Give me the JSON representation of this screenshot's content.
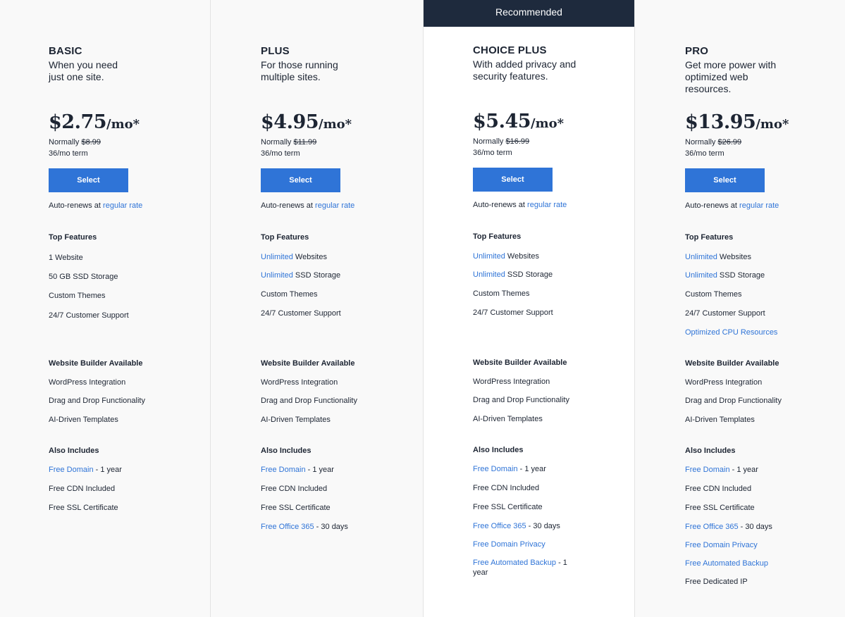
{
  "recommended_label": "Recommended",
  "plans": [
    {
      "name": "BASIC",
      "description": "When you need just one site.",
      "price": "$2.75",
      "per": "/mo*",
      "normally_label": "Normally",
      "normal_price": "$8.99",
      "term": "36/mo term",
      "select_label": "Select",
      "auto_renew_text": "Auto-renews at",
      "auto_renew_link": "regular rate",
      "top_features_title": "Top Features",
      "top_features": [
        {
          "link": "",
          "text": "1 Website"
        },
        {
          "link": "",
          "text": "50 GB SSD Storage"
        },
        {
          "link": "",
          "text": "Custom Themes"
        },
        {
          "link": "",
          "text": "24/7 Customer Support"
        }
      ],
      "builder_title": "Website Builder Available",
      "builder_features": [
        "WordPress Integration",
        "Drag and Drop Functionality",
        "AI-Driven Templates"
      ],
      "also_title": "Also Includes",
      "also_includes": [
        {
          "link": "Free Domain",
          "text": " - 1 year"
        },
        {
          "link": "",
          "text": "Free CDN Included"
        },
        {
          "link": "",
          "text": "Free SSL Certificate"
        }
      ]
    },
    {
      "name": "PLUS",
      "description": "For those running multiple sites.",
      "price": "$4.95",
      "per": "/mo*",
      "normally_label": "Normally",
      "normal_price": "$11.99",
      "term": "36/mo term",
      "select_label": "Select",
      "auto_renew_text": "Auto-renews at",
      "auto_renew_link": "regular rate",
      "top_features_title": "Top Features",
      "top_features": [
        {
          "link": "Unlimited",
          "text": " Websites"
        },
        {
          "link": "Unlimited",
          "text": " SSD Storage"
        },
        {
          "link": "",
          "text": "Custom Themes"
        },
        {
          "link": "",
          "text": "24/7 Customer Support"
        }
      ],
      "builder_title": "Website Builder Available",
      "builder_features": [
        "WordPress Integration",
        "Drag and Drop Functionality",
        "AI-Driven Templates"
      ],
      "also_title": "Also Includes",
      "also_includes": [
        {
          "link": "Free Domain",
          "text": " - 1 year"
        },
        {
          "link": "",
          "text": "Free CDN Included"
        },
        {
          "link": "",
          "text": "Free SSL Certificate"
        },
        {
          "link": "Free Office 365",
          "text": " - 30 days"
        }
      ]
    },
    {
      "name": "CHOICE PLUS",
      "description": "With added privacy and security features.",
      "price": "$5.45",
      "per": "/mo*",
      "normally_label": "Normally",
      "normal_price": "$16.99",
      "term": "36/mo term",
      "select_label": "Select",
      "auto_renew_text": "Auto-renews at",
      "auto_renew_link": "regular rate",
      "top_features_title": "Top Features",
      "top_features": [
        {
          "link": "Unlimited",
          "text": " Websites"
        },
        {
          "link": "Unlimited",
          "text": " SSD Storage"
        },
        {
          "link": "",
          "text": "Custom Themes"
        },
        {
          "link": "",
          "text": "24/7 Customer Support"
        }
      ],
      "builder_title": "Website Builder Available",
      "builder_features": [
        "WordPress Integration",
        "Drag and Drop Functionality",
        "AI-Driven Templates"
      ],
      "also_title": "Also Includes",
      "also_includes": [
        {
          "link": "Free Domain",
          "text": " - 1 year"
        },
        {
          "link": "",
          "text": "Free CDN Included"
        },
        {
          "link": "",
          "text": "Free SSL Certificate"
        },
        {
          "link": "Free Office 365",
          "text": " - 30 days"
        },
        {
          "link": "Free Domain Privacy",
          "text": ""
        },
        {
          "link": "Free Automated Backup",
          "text": " - 1 year"
        }
      ]
    },
    {
      "name": "PRO",
      "description": "Get more power with optimized web resources.",
      "price": "$13.95",
      "per": "/mo*",
      "normally_label": "Normally",
      "normal_price": "$26.99",
      "term": "36/mo term",
      "select_label": "Select",
      "auto_renew_text": "Auto-renews at",
      "auto_renew_link": "regular rate",
      "top_features_title": "Top Features",
      "top_features": [
        {
          "link": "Unlimited",
          "text": " Websites"
        },
        {
          "link": "Unlimited",
          "text": " SSD Storage"
        },
        {
          "link": "",
          "text": "Custom Themes"
        },
        {
          "link": "",
          "text": "24/7 Customer Support"
        },
        {
          "link": "Optimized CPU Resources",
          "text": ""
        }
      ],
      "builder_title": "Website Builder Available",
      "builder_features": [
        "WordPress Integration",
        "Drag and Drop Functionality",
        "AI-Driven Templates"
      ],
      "also_title": "Also Includes",
      "also_includes": [
        {
          "link": "Free Domain",
          "text": " - 1 year"
        },
        {
          "link": "",
          "text": "Free CDN Included"
        },
        {
          "link": "",
          "text": "Free SSL Certificate"
        },
        {
          "link": "Free Office 365",
          "text": " - 30 days"
        },
        {
          "link": "Free Domain Privacy",
          "text": ""
        },
        {
          "link": "Free Automated Backup",
          "text": ""
        },
        {
          "link": "",
          "text": "Free Dedicated IP"
        }
      ]
    }
  ]
}
